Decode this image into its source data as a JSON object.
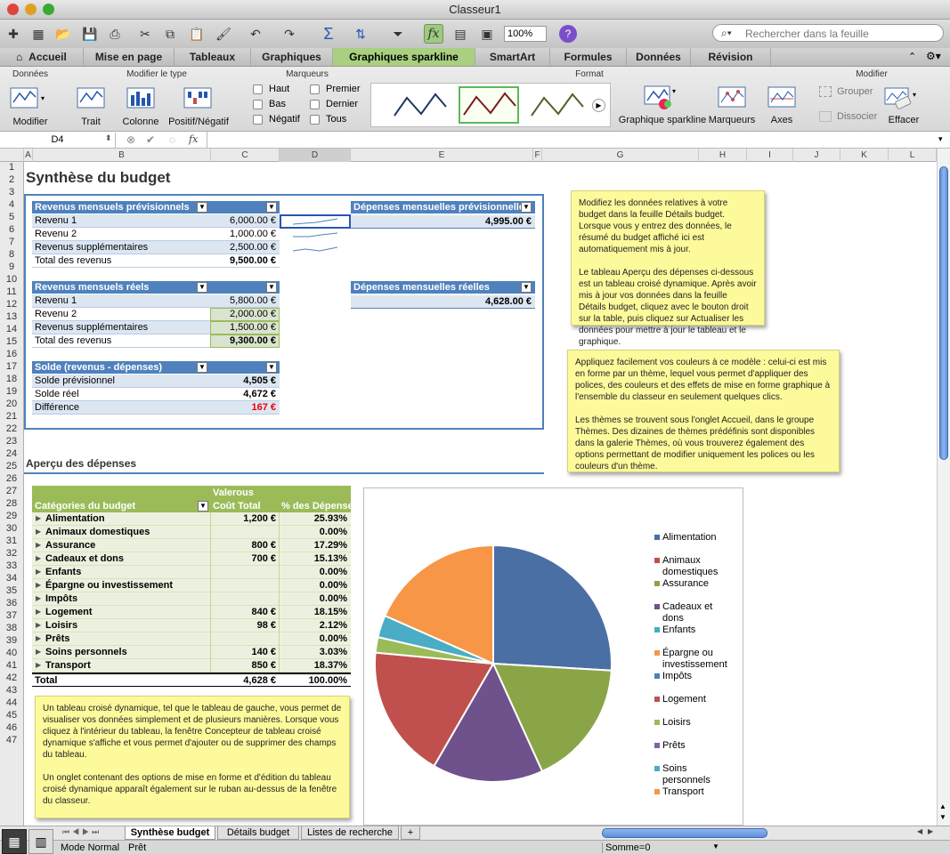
{
  "app": {
    "title": "Classeur1",
    "zoom": "100%",
    "search_placeholder": "Rechercher dans la feuille"
  },
  "tabs": [
    "Accueil",
    "Mise en page",
    "Tableaux",
    "Graphiques",
    "Graphiques sparkline",
    "SmartArt",
    "Formules",
    "Données",
    "Révision"
  ],
  "ribbon": {
    "groups": [
      "Données",
      "Modifier le type",
      "Marqueurs",
      "Format",
      "Modifier"
    ],
    "modifier": "Modifier",
    "trait": "Trait",
    "colonne": "Colonne",
    "posneg": "Positif/Négatif",
    "markers": [
      "Haut",
      "Bas",
      "Négatif",
      "Premier",
      "Dernier",
      "Tous"
    ],
    "gs": "Graphique sparkline",
    "marqueurs": "Marqueurs",
    "axes": "Axes",
    "grouper": "Grouper",
    "dissocier": "Dissocier",
    "effacer": "Effacer"
  },
  "namebox": "D4",
  "columns": [
    "A",
    "B",
    "C",
    "D",
    "E",
    "F",
    "G",
    "H",
    "I",
    "J",
    "K",
    "L"
  ],
  "rows": [
    "1",
    "2",
    "3",
    "4",
    "5",
    "6",
    "7",
    "8",
    "9",
    "10",
    "11",
    "12",
    "13",
    "14",
    "15",
    "16",
    "17",
    "18",
    "19",
    "20",
    "21",
    "22",
    "23",
    "24",
    "25",
    "26",
    "27",
    "28",
    "29",
    "30",
    "31",
    "32",
    "33",
    "34",
    "35",
    "36",
    "37",
    "38",
    "39",
    "40",
    "41",
    "42",
    "43",
    "44",
    "45",
    "46",
    "47"
  ],
  "sheet": {
    "title": "Synthèse du budget",
    "rev_prev": {
      "header": "Revenus mensuels prévisionnels",
      "rows": [
        [
          "Revenu 1",
          "6,000.00 €"
        ],
        [
          "Revenu 2",
          "1,000.00 €"
        ],
        [
          "Revenus supplémentaires",
          "2,500.00 €"
        ],
        [
          "Total des revenus",
          "9,500.00 €"
        ]
      ]
    },
    "rev_reel": {
      "header": "Revenus mensuels réels",
      "rows": [
        [
          "Revenu 1",
          "5,800.00 €"
        ],
        [
          "Revenu 2",
          "2,000.00 €"
        ],
        [
          "Revenus supplémentaires",
          "1,500.00 €"
        ],
        [
          "Total des revenus",
          "9,300.00 €"
        ]
      ]
    },
    "solde": {
      "header": "Solde (revenus - dépenses)",
      "rows": [
        [
          "Solde prévisionnel",
          "4,505 €"
        ],
        [
          "Solde réel",
          "4,672 €"
        ],
        [
          "Différence",
          "167 €"
        ]
      ]
    },
    "dep_prev": {
      "header": "Dépenses mensuelles prévisionnelles",
      "value": "4,995.00 €"
    },
    "dep_reel": {
      "header": "Dépenses mensuelles réelles",
      "value": "4,628.00 €"
    },
    "apercu": "Aperçu des dépenses",
    "pivot": {
      "col1": "Catégories du budget",
      "col2a": "Valerous",
      "col2b": "Coût Total",
      "col3": "% des Dépenses",
      "rows": [
        [
          "Alimentation",
          "1,200 €",
          "25.93%"
        ],
        [
          "Animaux domestiques",
          "",
          "0.00%"
        ],
        [
          "Assurance",
          "800 €",
          "17.29%"
        ],
        [
          "Cadeaux et dons",
          "700 €",
          "15.13%"
        ],
        [
          "Enfants",
          "",
          "0.00%"
        ],
        [
          "Épargne ou investissement",
          "",
          "0.00%"
        ],
        [
          "Impôts",
          "",
          "0.00%"
        ],
        [
          "Logement",
          "840 €",
          "18.15%"
        ],
        [
          "Loisirs",
          "98 €",
          "2.12%"
        ],
        [
          "Prêts",
          "",
          "0.00%"
        ],
        [
          "Soins personnels",
          "140 €",
          "3.03%"
        ],
        [
          "Transport",
          "850 €",
          "18.37%"
        ]
      ],
      "total": [
        "Total",
        "4,628 €",
        "100.00%"
      ]
    }
  },
  "notes": {
    "n1a": "Modifiez les données relatives à votre budget dans la feuille Détails budget. Lorsque vous y entrez des données, le résumé du budget affiché ici est automatiquement mis à jour.",
    "n1b": "Le tableau Aperçu des dépenses ci-dessous est un tableau croisé dynamique. Après avoir mis à jour vos données dans la feuille Détails budget, cliquez avec le bouton droit sur la table, puis cliquez sur Actualiser les données pour mettre à jour le tableau et le graphique.",
    "n2a": "Appliquez facilement vos couleurs à ce modèle : celui-ci est mis en forme par un thème, lequel vous permet d'appliquer des polices, des couleurs et des effets de mise en forme graphique à l'ensemble du classeur en seulement quelques clics.",
    "n2b": "Les thèmes se trouvent sous l'onglet Accueil, dans le groupe Thèmes. Des dizaines de thèmes prédéfinis sont disponibles dans la galerie Thèmes, où vous trouverez également des options permettant de modifier uniquement les polices ou les couleurs d'un thème.",
    "n3a": "Un tableau croisé dynamique, tel que le tableau de gauche, vous permet de visualiser vos données simplement et de plusieurs manières. Lorsque vous cliquez à l'intérieur du tableau, la fenêtre Concepteur de tableau croisé dynamique s'affiche et vous permet d'ajouter ou de supprimer des champs du tableau.",
    "n3b": "Un onglet contenant des options de mise en forme et d'édition du tableau croisé dynamique apparaît également sur le ruban au-dessus de la fenêtre du classeur."
  },
  "chart_data": {
    "type": "pie",
    "categories": [
      "Alimentation",
      "Animaux domestiques",
      "Assurance",
      "Cadeaux et dons",
      "Enfants",
      "Épargne ou investissement",
      "Impôts",
      "Logement",
      "Loisirs",
      "Prêts",
      "Soins personnels",
      "Transport"
    ],
    "values": [
      25.93,
      0,
      17.29,
      15.13,
      0,
      0,
      0,
      18.15,
      2.12,
      0,
      3.03,
      18.37
    ],
    "colors": [
      "#4a6fa5",
      "#c0504d",
      "#8aa547",
      "#6f528c",
      "#4bacc6",
      "#f79646",
      "#4f81bd",
      "#c0504d",
      "#9bbb59",
      "#8064a2",
      "#4bacc6",
      "#f79646"
    ],
    "legend": "right"
  },
  "sheet_tabs": [
    "Synthèse budget",
    "Détails budget",
    "Listes de recherche"
  ],
  "status": {
    "mode": "Mode Normal",
    "ready": "Prêt",
    "sum": "Somme=0"
  }
}
